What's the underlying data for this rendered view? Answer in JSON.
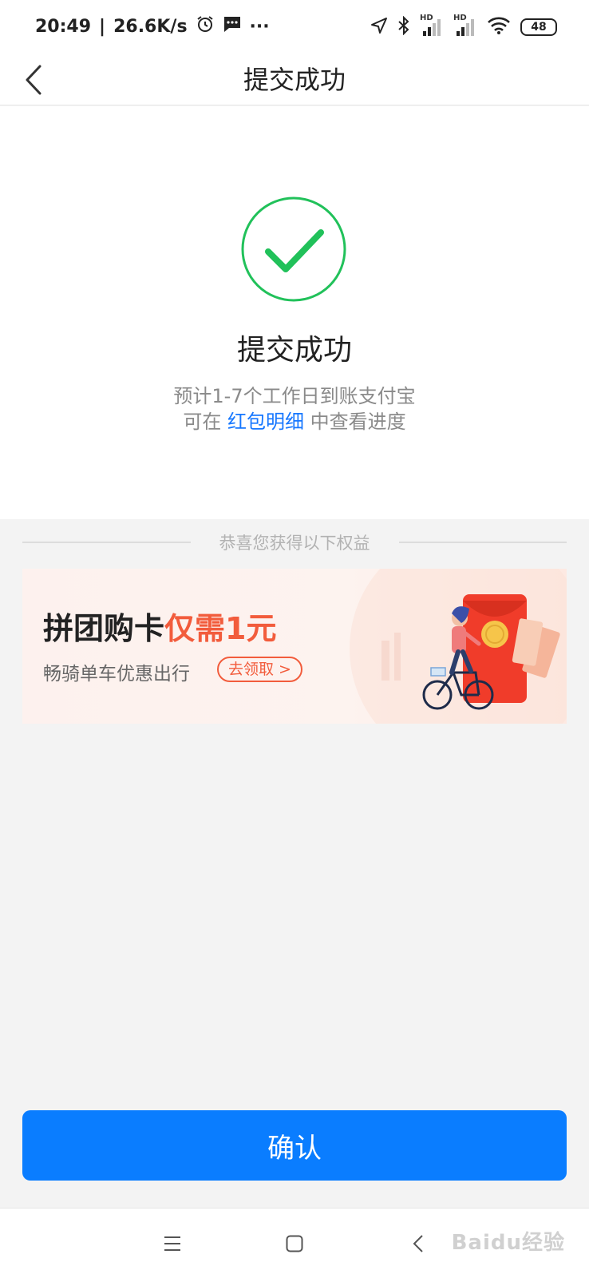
{
  "status_bar": {
    "time": "20:49",
    "speed": "26.6K/s",
    "more": "···",
    "hd1": "HD",
    "hd2": "HD",
    "battery": "48"
  },
  "header": {
    "title": "提交成功"
  },
  "success": {
    "title": "提交成功",
    "line1": "预计1-7个工作日到账支付宝",
    "line2_prefix": "可在",
    "line2_link": "红包明细",
    "line2_suffix": "中查看进度"
  },
  "benefits": {
    "divider_text": "恭喜您获得以下权益",
    "promo": {
      "title_main": "拼团购卡",
      "title_accent": "仅需1元",
      "subtitle": "畅骑单车优惠出行",
      "cta": "去领取 >"
    }
  },
  "confirm": {
    "label": "确认"
  },
  "watermark": "Baidu经验",
  "colors": {
    "primary_blue": "#0a7dff",
    "link_blue": "#1677ff",
    "success_green": "#21c15a",
    "promo_red": "#f25c3c"
  }
}
